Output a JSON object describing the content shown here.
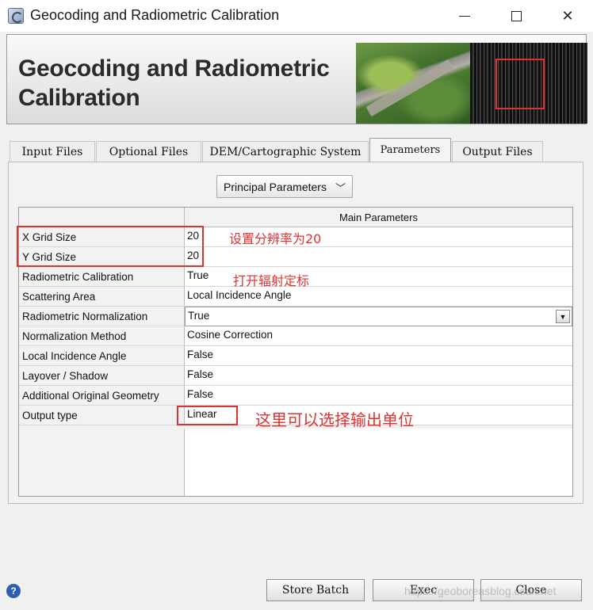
{
  "window": {
    "title": "Geocoding and Radiometric Calibration",
    "icon": "app-icon"
  },
  "banner": {
    "title": "Geocoding and Radiometric Calibration"
  },
  "tabs": [
    {
      "label": "Input Files",
      "active": false
    },
    {
      "label": "Optional Files",
      "active": false
    },
    {
      "label": "DEM/Cartographic System",
      "active": false
    },
    {
      "label": "Parameters",
      "active": true
    },
    {
      "label": "Output Files",
      "active": false
    }
  ],
  "combo": {
    "value": "Principal Parameters"
  },
  "table": {
    "header": "Main Parameters",
    "rows": [
      {
        "label": "X Grid Size",
        "value": "20"
      },
      {
        "label": "Y Grid Size",
        "value": "20"
      },
      {
        "label": "Radiometric Calibration",
        "value": "True"
      },
      {
        "label": "Scattering Area",
        "value": "Local Incidence Angle"
      },
      {
        "label": "Radiometric Normalization",
        "value": "True"
      },
      {
        "label": "Normalization Method",
        "value": "Cosine Correction"
      },
      {
        "label": "Local Incidence Angle",
        "value": "False"
      },
      {
        "label": "Layover / Shadow",
        "value": "False"
      },
      {
        "label": "Additional Original Geometry",
        "value": "False"
      },
      {
        "label": "Output type",
        "value": "Linear"
      }
    ]
  },
  "annotations": {
    "grid": "设置分辨率为20",
    "calibration": "打开辐射定标",
    "output": "这里可以选择输出单位"
  },
  "buttons": {
    "store_batch": "Store Batch",
    "exec": "Exec",
    "close": "Close"
  },
  "watermark": "https://geoboreasblog.csdn.net",
  "colors": {
    "annotation": "#e03131",
    "background": "#f0f0f0"
  }
}
